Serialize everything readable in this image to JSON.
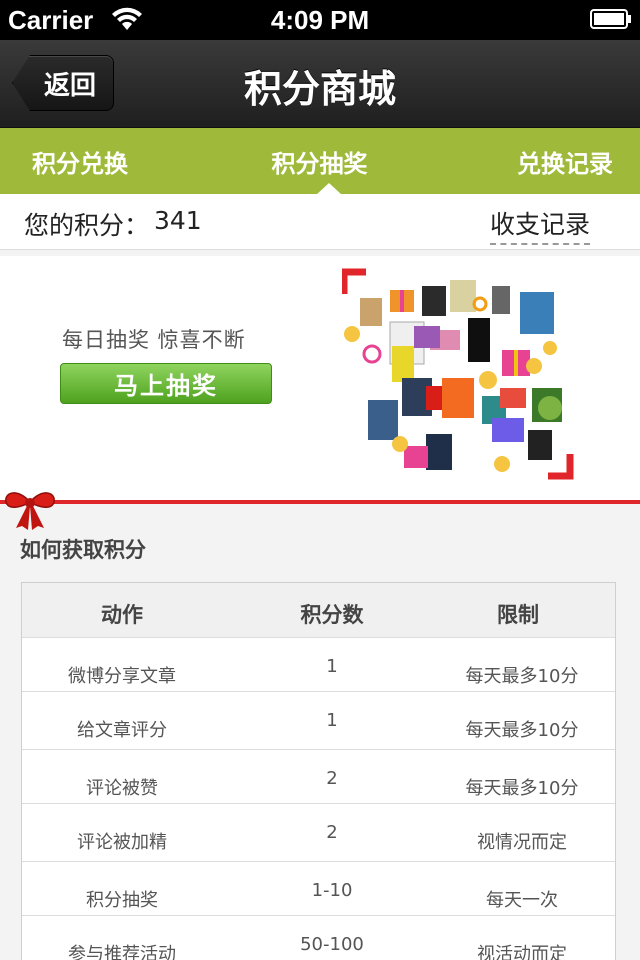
{
  "status_bar": {
    "carrier": "Carrier",
    "time": "4:09 PM"
  },
  "nav": {
    "back_label": "返回",
    "title": "积分商城"
  },
  "tabs": [
    {
      "label": "积分兑换"
    },
    {
      "label": "积分抽奖"
    },
    {
      "label": "兑换记录"
    }
  ],
  "points": {
    "label": "您的积分：",
    "value": "341",
    "ledger_link": "收支记录"
  },
  "banner": {
    "tagline": "每日抽奖   惊喜不断",
    "button_label": "马上抽奖"
  },
  "section": {
    "title": "如何获取积分"
  },
  "table": {
    "headers": [
      "动作",
      "积分数",
      "限制"
    ],
    "rows": [
      [
        "微博分享文章",
        "1",
        "每天最多10分"
      ],
      [
        "给文章评分",
        "1",
        "每天最多10分"
      ],
      [
        "评论被赞",
        "2",
        "每天最多10分"
      ],
      [
        "评论被加精",
        "2",
        "视情况而定"
      ],
      [
        "积分抽奖",
        "1-10",
        "每天一次"
      ],
      [
        "参与推荐活动",
        "50-100",
        "视活动而定"
      ]
    ]
  },
  "colors": {
    "tab_green": "#9fba3a",
    "button_green": "#5aad28",
    "ribbon_red": "#e0262a"
  }
}
